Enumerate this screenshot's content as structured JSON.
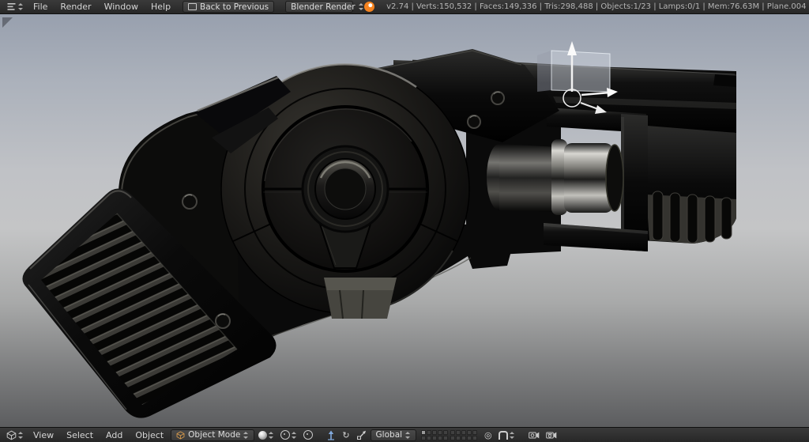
{
  "header": {
    "editor_icon": "info-editor-icon",
    "menus": [
      "File",
      "Render",
      "Window",
      "Help"
    ],
    "back_button_label": "Back to Previous",
    "render_engine": "Blender Render",
    "stats": "v2.74 | Verts:150,532 | Faces:149,336 | Tris:298,488 | Objects:1/23 | Lamps:0/1 | Mem:76.63M | Plane.004"
  },
  "footer": {
    "editor_icon": "3d-viewport-editor-icon",
    "menus": [
      "View",
      "Select",
      "Add",
      "Object"
    ],
    "interaction_mode": "Object Mode",
    "transform_orientation": "Global",
    "layers": {
      "rows": 2,
      "cols": 10,
      "active_index": 0
    },
    "icons": [
      "viewport-shading-sphere-icon",
      "pivot-center-icon",
      "translate-manipulator-icon",
      "rotate-manipulator-icon",
      "scale-manipulator-icon",
      "proportional-edit-icon",
      "snap-magnet-icon",
      "opengl-render-icon",
      "opengl-render-animation-icon"
    ]
  },
  "viewport": {
    "scene_object": "black glossy sci-fi pistol 3D model",
    "manipulator_icon": "translate-gizmo-icon"
  },
  "colors": {
    "bar_bg": "#2b2b2b",
    "button_bg": "#3e3e3e",
    "text": "#d8d8d8",
    "accent_orange": "#f5831f",
    "viewport_gradient_top": "#98a0ae",
    "viewport_gradient_mid": "#c4c5c6",
    "viewport_gradient_bottom": "#5c5d5f"
  }
}
